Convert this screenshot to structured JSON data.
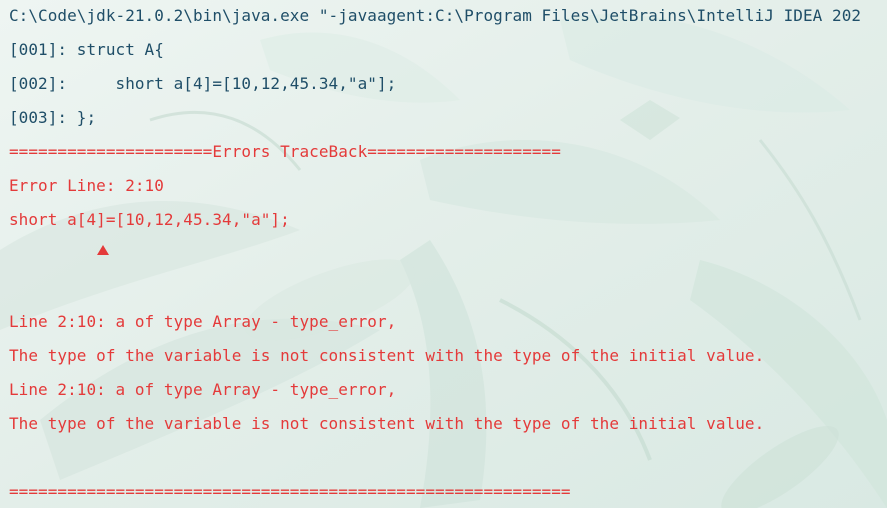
{
  "console": {
    "command": "C:\\Code\\jdk-21.0.2\\bin\\java.exe \"-javaagent:C:\\Program Files\\JetBrains\\IntelliJ IDEA 202",
    "source_lines": [
      "[001]: struct A{",
      "[002]:     short a[4]=[10,12,45.34,\"a\"];",
      "[003]: };"
    ],
    "traceback_header": "=====================Errors TraceBack====================",
    "error_line": "Error Line: 2:10",
    "error_source": "short a[4]=[10,12,45.34,\"a\"];",
    "caret_icon": "caret-up-icon",
    "messages": [
      "Line 2:10: a of type Array - type_error,",
      "The type of the variable is not consistent with the type of the initial value.",
      "Line 2:10: a of type Array - type_error,",
      "The type of the variable is not consistent with the type of the initial value."
    ],
    "footer_rule": "=========================================================="
  },
  "colors": {
    "normal_text": "#1f4e68",
    "error_text": "#e43a3a",
    "background": "#e6f0ec"
  }
}
